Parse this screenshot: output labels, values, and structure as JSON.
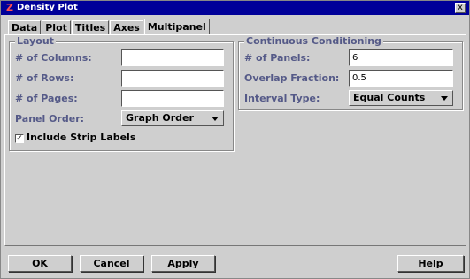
{
  "window": {
    "title": "Density Plot",
    "close_glyph": "x",
    "app_glyph": "Z"
  },
  "tabs": [
    {
      "label": "Data"
    },
    {
      "label": "Plot"
    },
    {
      "label": "Titles"
    },
    {
      "label": "Axes"
    },
    {
      "label": "Multipanel"
    }
  ],
  "active_tab": "Multipanel",
  "layout": {
    "title": "Layout",
    "columns_label": "# of Columns:",
    "columns_value": "",
    "rows_label": "# of Rows:",
    "rows_value": "",
    "pages_label": "# of Pages:",
    "pages_value": "",
    "panel_order_label": "Panel Order:",
    "panel_order_value": "Graph Order",
    "strip_labels_label": "Include Strip Labels",
    "strip_labels_checked": true,
    "check_glyph": "✓"
  },
  "conditioning": {
    "title": "Continuous Conditioning",
    "panels_label": "# of Panels:",
    "panels_value": "6",
    "overlap_label": "Overlap Fraction:",
    "overlap_value": "0.5",
    "interval_label": "Interval Type:",
    "interval_value": "Equal Counts"
  },
  "buttons": {
    "ok": "OK",
    "cancel": "Cancel",
    "apply": "Apply",
    "help": "Help"
  }
}
